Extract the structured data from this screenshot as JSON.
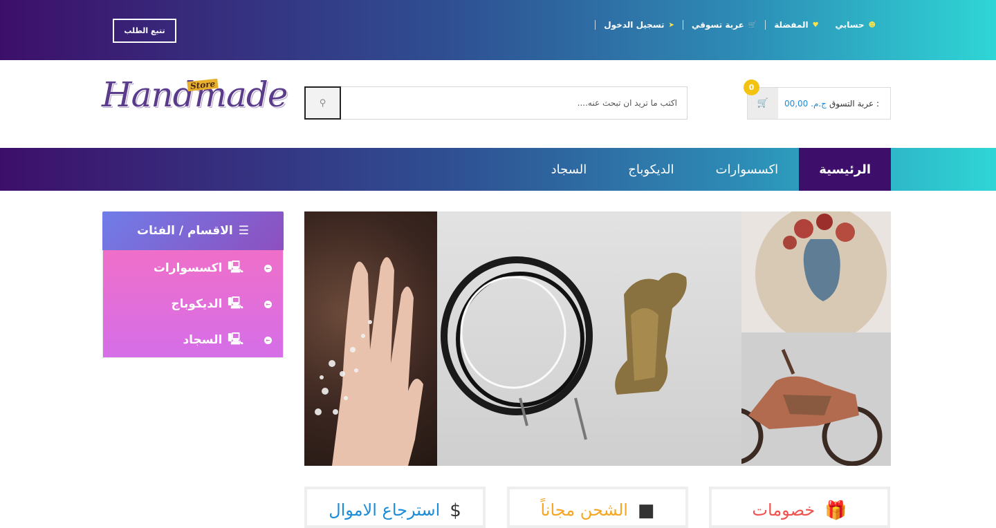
{
  "topbar": {
    "track_order": "تتبع الطلب",
    "links": [
      {
        "label": "حسابي",
        "icon": "user-icon"
      },
      {
        "label": "المفضلة",
        "icon": "heart-icon"
      },
      {
        "label": "عربة تسوقي",
        "icon": "cart-icon"
      },
      {
        "label": "تسجيل الدخول",
        "icon": "sign-in-icon"
      }
    ]
  },
  "logo": {
    "main": "Handmade",
    "badge": "Store"
  },
  "search": {
    "placeholder": "اكتب ما تريد ان تبحث عنه...."
  },
  "cart": {
    "label": "عربة التسوق :",
    "price": "ج.م. 00,00",
    "count": "0"
  },
  "nav": {
    "items": [
      "الرئيسية",
      "اكسسوارات",
      "الديكوباج",
      "السجاد"
    ]
  },
  "categories": {
    "title": "الاقسام / الفئات",
    "items": [
      "اكسسوارات",
      "الديكوباج",
      "السجاد"
    ]
  },
  "features": [
    {
      "label": "خصومات",
      "color": "#ef5350",
      "icon": "gift-icon"
    },
    {
      "label": "الشحن مجاناً",
      "color": "#f5a623",
      "icon": "truck-icon"
    },
    {
      "label": "استرجاع الاموال",
      "color": "#1a8cd8",
      "icon": "dollar-icon"
    }
  ],
  "colors": {
    "brand_dark": "#3d0f6b",
    "brand_teal": "#2fd6d6",
    "badge": "#f2c311"
  }
}
